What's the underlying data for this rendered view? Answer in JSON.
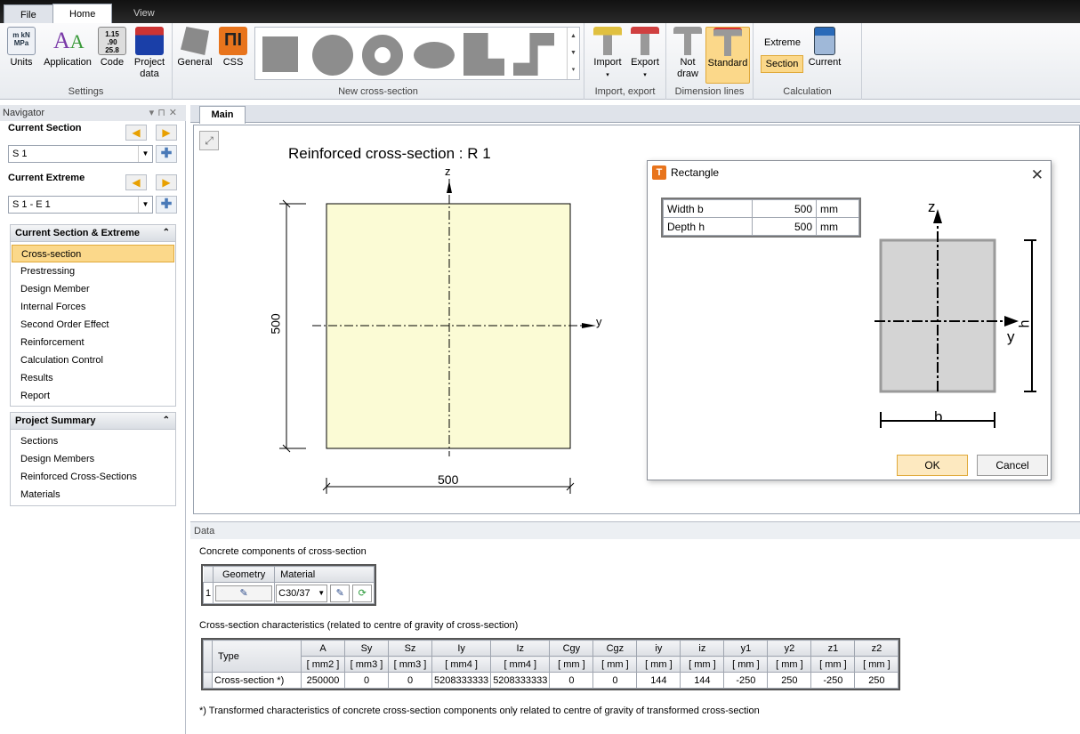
{
  "ribbon": {
    "tabs": [
      {
        "label": "File"
      },
      {
        "label": "Home"
      },
      {
        "label": "View"
      }
    ],
    "settings": {
      "units": "Units",
      "application": "Application",
      "code": "Code",
      "project_data_1": "Project",
      "project_data_2": "data",
      "group": "Settings"
    },
    "newcs": {
      "general": "General",
      "css": "CSS",
      "group": "New cross-section"
    },
    "importexport": {
      "import": "Import",
      "export": "Export",
      "group": "Import, export"
    },
    "dimlines": {
      "notdraw_1": "Not",
      "notdraw_2": "draw",
      "standard": "Standard",
      "group": "Dimension lines"
    },
    "calc": {
      "extreme": "Extreme",
      "section": "Section",
      "current": "Current",
      "group": "Calculation"
    }
  },
  "navigator": {
    "title": "Navigator",
    "current_section_label": "Current Section",
    "current_section_value": "S 1",
    "current_extreme_label": "Current Extreme",
    "current_extreme_value": "S 1 - E 1",
    "panel1_title": "Current Section & Extreme",
    "panel1_items": [
      "Cross-section",
      "Prestressing",
      "Design Member",
      "Internal Forces",
      "Second Order Effect",
      "Reinforcement",
      "Calculation Control",
      "Results",
      "Report"
    ],
    "panel2_title": "Project Summary",
    "panel2_items": [
      "Sections",
      "Design Members",
      "Reinforced Cross-Sections",
      "Materials"
    ]
  },
  "main": {
    "tab": "Main",
    "drawing": {
      "title": "Reinforced cross-section : R 1",
      "z_label": "z",
      "y_label": "y",
      "height_dim": "500",
      "width_dim": "500"
    },
    "fill_color": "#fbfbd5"
  },
  "data": {
    "header": "Data",
    "concrete_title": "Concrete components of cross-section",
    "geometry_header": "Geometry",
    "material_header": "Material",
    "row_no": "1",
    "material_value": "C30/37",
    "char_title": "Cross-section characteristics (related to centre of gravity of cross-section)",
    "char_headers": [
      "Type",
      "A",
      "Sy",
      "Sz",
      "Iy",
      "Iz",
      "Cgy",
      "Cgz",
      "iy",
      "iz",
      "y1",
      "y2",
      "z1",
      "z2"
    ],
    "char_units": [
      "[ mm2 ]",
      "[ mm3 ]",
      "[ mm3 ]",
      "[ mm4 ]",
      "[ mm4 ]",
      "[ mm ]",
      "[ mm ]",
      "[ mm ]",
      "[ mm ]",
      "[ mm ]",
      "[ mm ]",
      "[ mm ]",
      "[ mm ]"
    ],
    "char_row": [
      "Cross-section *)",
      "250000",
      "0",
      "0",
      "5208333333",
      "5208333333",
      "0",
      "0",
      "144",
      "144",
      "-250",
      "250",
      "-250",
      "250"
    ],
    "footnote": "*) Transformed characteristics of concrete cross-section components only related to centre of gravity of transformed cross-section"
  },
  "dialog": {
    "title": "Rectangle",
    "rows": [
      {
        "label": "Width b",
        "value": "500",
        "unit": "mm"
      },
      {
        "label": "Depth h",
        "value": "500",
        "unit": "mm"
      }
    ],
    "diagram": {
      "z": "z",
      "y": "y",
      "h": "h",
      "b": "b"
    },
    "ok": "OK",
    "cancel": "Cancel"
  }
}
